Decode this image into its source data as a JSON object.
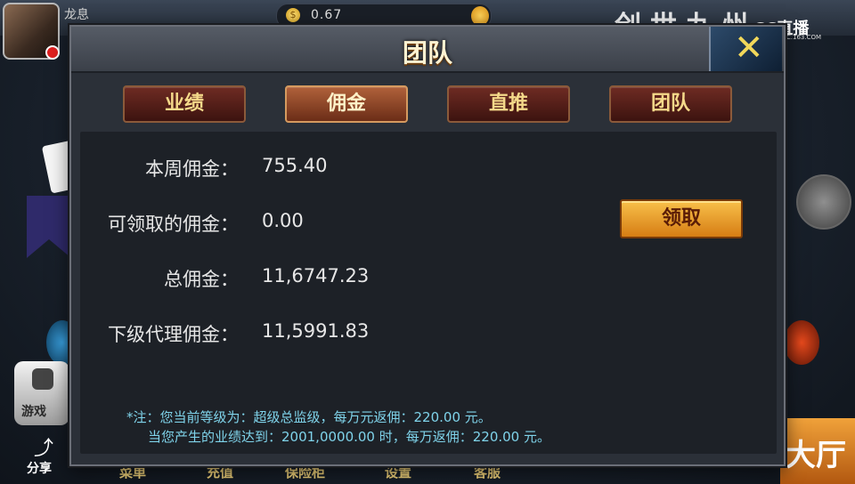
{
  "header": {
    "username": "龙息",
    "coin_value": "0.67",
    "brand_text": "创世九州",
    "watermark": "CC直播",
    "watermark_sub": "CC.163.COM"
  },
  "lobby": {
    "games_label": "游戏",
    "share_label": "分享",
    "bottom_items": [
      "菜单",
      "充值",
      "保险柜",
      "设置",
      "客服"
    ],
    "hall_label": "大厅"
  },
  "dialog": {
    "title": "团队",
    "close_label": "✕",
    "tabs": [
      {
        "label": "业绩",
        "active": false
      },
      {
        "label": "佣金",
        "active": true
      },
      {
        "label": "直推",
        "active": false
      },
      {
        "label": "团队",
        "active": false
      }
    ],
    "rows": [
      {
        "label": "本周佣金：",
        "value": "755.40"
      },
      {
        "label": "可领取的佣金：",
        "value": "0.00"
      },
      {
        "label": "总佣金：",
        "value": "11,6747.23"
      },
      {
        "label": "下级代理佣金：",
        "value": "11,5991.83"
      }
    ],
    "claim_button": "领取",
    "notes": [
      "*注：您当前等级为：超级总监级，每万元返佣：220.00 元。",
      "当您产生的业绩达到：2001,0000.00 时，每万返佣：220.00 元。"
    ]
  },
  "colors": {
    "tab_active": "#b0613a",
    "tab_inactive": "#6e2b23",
    "claim_button": "#f0a830",
    "note_text": "#7fd3ea"
  }
}
